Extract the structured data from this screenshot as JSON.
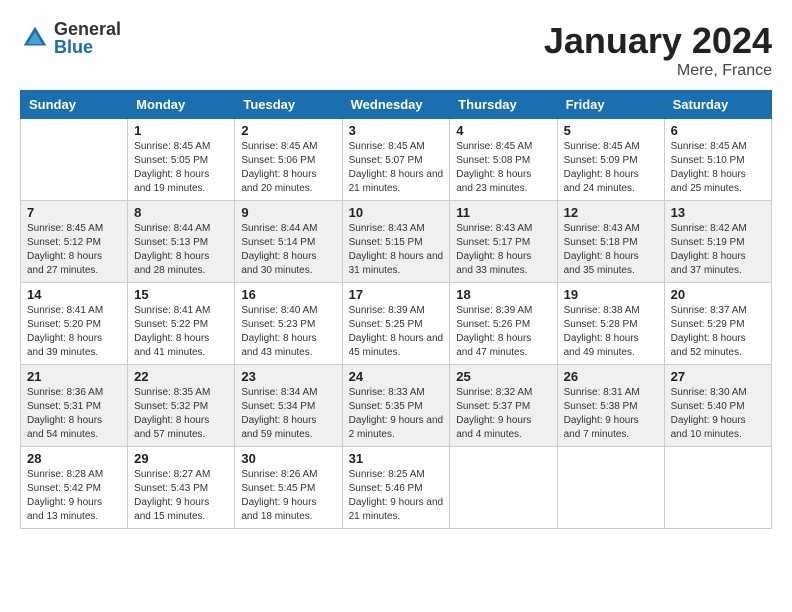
{
  "logo": {
    "general": "General",
    "blue": "Blue"
  },
  "title": "January 2024",
  "location": "Mere, France",
  "days_of_week": [
    "Sunday",
    "Monday",
    "Tuesday",
    "Wednesday",
    "Thursday",
    "Friday",
    "Saturday"
  ],
  "weeks": [
    [
      {
        "day": "",
        "sunrise": "",
        "sunset": "",
        "daylight": ""
      },
      {
        "day": "1",
        "sunrise": "Sunrise: 8:45 AM",
        "sunset": "Sunset: 5:05 PM",
        "daylight": "Daylight: 8 hours and 19 minutes."
      },
      {
        "day": "2",
        "sunrise": "Sunrise: 8:45 AM",
        "sunset": "Sunset: 5:06 PM",
        "daylight": "Daylight: 8 hours and 20 minutes."
      },
      {
        "day": "3",
        "sunrise": "Sunrise: 8:45 AM",
        "sunset": "Sunset: 5:07 PM",
        "daylight": "Daylight: 8 hours and 21 minutes."
      },
      {
        "day": "4",
        "sunrise": "Sunrise: 8:45 AM",
        "sunset": "Sunset: 5:08 PM",
        "daylight": "Daylight: 8 hours and 23 minutes."
      },
      {
        "day": "5",
        "sunrise": "Sunrise: 8:45 AM",
        "sunset": "Sunset: 5:09 PM",
        "daylight": "Daylight: 8 hours and 24 minutes."
      },
      {
        "day": "6",
        "sunrise": "Sunrise: 8:45 AM",
        "sunset": "Sunset: 5:10 PM",
        "daylight": "Daylight: 8 hours and 25 minutes."
      }
    ],
    [
      {
        "day": "7",
        "sunrise": "Sunrise: 8:45 AM",
        "sunset": "Sunset: 5:12 PM",
        "daylight": "Daylight: 8 hours and 27 minutes."
      },
      {
        "day": "8",
        "sunrise": "Sunrise: 8:44 AM",
        "sunset": "Sunset: 5:13 PM",
        "daylight": "Daylight: 8 hours and 28 minutes."
      },
      {
        "day": "9",
        "sunrise": "Sunrise: 8:44 AM",
        "sunset": "Sunset: 5:14 PM",
        "daylight": "Daylight: 8 hours and 30 minutes."
      },
      {
        "day": "10",
        "sunrise": "Sunrise: 8:43 AM",
        "sunset": "Sunset: 5:15 PM",
        "daylight": "Daylight: 8 hours and 31 minutes."
      },
      {
        "day": "11",
        "sunrise": "Sunrise: 8:43 AM",
        "sunset": "Sunset: 5:17 PM",
        "daylight": "Daylight: 8 hours and 33 minutes."
      },
      {
        "day": "12",
        "sunrise": "Sunrise: 8:43 AM",
        "sunset": "Sunset: 5:18 PM",
        "daylight": "Daylight: 8 hours and 35 minutes."
      },
      {
        "day": "13",
        "sunrise": "Sunrise: 8:42 AM",
        "sunset": "Sunset: 5:19 PM",
        "daylight": "Daylight: 8 hours and 37 minutes."
      }
    ],
    [
      {
        "day": "14",
        "sunrise": "Sunrise: 8:41 AM",
        "sunset": "Sunset: 5:20 PM",
        "daylight": "Daylight: 8 hours and 39 minutes."
      },
      {
        "day": "15",
        "sunrise": "Sunrise: 8:41 AM",
        "sunset": "Sunset: 5:22 PM",
        "daylight": "Daylight: 8 hours and 41 minutes."
      },
      {
        "day": "16",
        "sunrise": "Sunrise: 8:40 AM",
        "sunset": "Sunset: 5:23 PM",
        "daylight": "Daylight: 8 hours and 43 minutes."
      },
      {
        "day": "17",
        "sunrise": "Sunrise: 8:39 AM",
        "sunset": "Sunset: 5:25 PM",
        "daylight": "Daylight: 8 hours and 45 minutes."
      },
      {
        "day": "18",
        "sunrise": "Sunrise: 8:39 AM",
        "sunset": "Sunset: 5:26 PM",
        "daylight": "Daylight: 8 hours and 47 minutes."
      },
      {
        "day": "19",
        "sunrise": "Sunrise: 8:38 AM",
        "sunset": "Sunset: 5:28 PM",
        "daylight": "Daylight: 8 hours and 49 minutes."
      },
      {
        "day": "20",
        "sunrise": "Sunrise: 8:37 AM",
        "sunset": "Sunset: 5:29 PM",
        "daylight": "Daylight: 8 hours and 52 minutes."
      }
    ],
    [
      {
        "day": "21",
        "sunrise": "Sunrise: 8:36 AM",
        "sunset": "Sunset: 5:31 PM",
        "daylight": "Daylight: 8 hours and 54 minutes."
      },
      {
        "day": "22",
        "sunrise": "Sunrise: 8:35 AM",
        "sunset": "Sunset: 5:32 PM",
        "daylight": "Daylight: 8 hours and 57 minutes."
      },
      {
        "day": "23",
        "sunrise": "Sunrise: 8:34 AM",
        "sunset": "Sunset: 5:34 PM",
        "daylight": "Daylight: 8 hours and 59 minutes."
      },
      {
        "day": "24",
        "sunrise": "Sunrise: 8:33 AM",
        "sunset": "Sunset: 5:35 PM",
        "daylight": "Daylight: 9 hours and 2 minutes."
      },
      {
        "day": "25",
        "sunrise": "Sunrise: 8:32 AM",
        "sunset": "Sunset: 5:37 PM",
        "daylight": "Daylight: 9 hours and 4 minutes."
      },
      {
        "day": "26",
        "sunrise": "Sunrise: 8:31 AM",
        "sunset": "Sunset: 5:38 PM",
        "daylight": "Daylight: 9 hours and 7 minutes."
      },
      {
        "day": "27",
        "sunrise": "Sunrise: 8:30 AM",
        "sunset": "Sunset: 5:40 PM",
        "daylight": "Daylight: 9 hours and 10 minutes."
      }
    ],
    [
      {
        "day": "28",
        "sunrise": "Sunrise: 8:28 AM",
        "sunset": "Sunset: 5:42 PM",
        "daylight": "Daylight: 9 hours and 13 minutes."
      },
      {
        "day": "29",
        "sunrise": "Sunrise: 8:27 AM",
        "sunset": "Sunset: 5:43 PM",
        "daylight": "Daylight: 9 hours and 15 minutes."
      },
      {
        "day": "30",
        "sunrise": "Sunrise: 8:26 AM",
        "sunset": "Sunset: 5:45 PM",
        "daylight": "Daylight: 9 hours and 18 minutes."
      },
      {
        "day": "31",
        "sunrise": "Sunrise: 8:25 AM",
        "sunset": "Sunset: 5:46 PM",
        "daylight": "Daylight: 9 hours and 21 minutes."
      },
      {
        "day": "",
        "sunrise": "",
        "sunset": "",
        "daylight": ""
      },
      {
        "day": "",
        "sunrise": "",
        "sunset": "",
        "daylight": ""
      },
      {
        "day": "",
        "sunrise": "",
        "sunset": "",
        "daylight": ""
      }
    ]
  ]
}
